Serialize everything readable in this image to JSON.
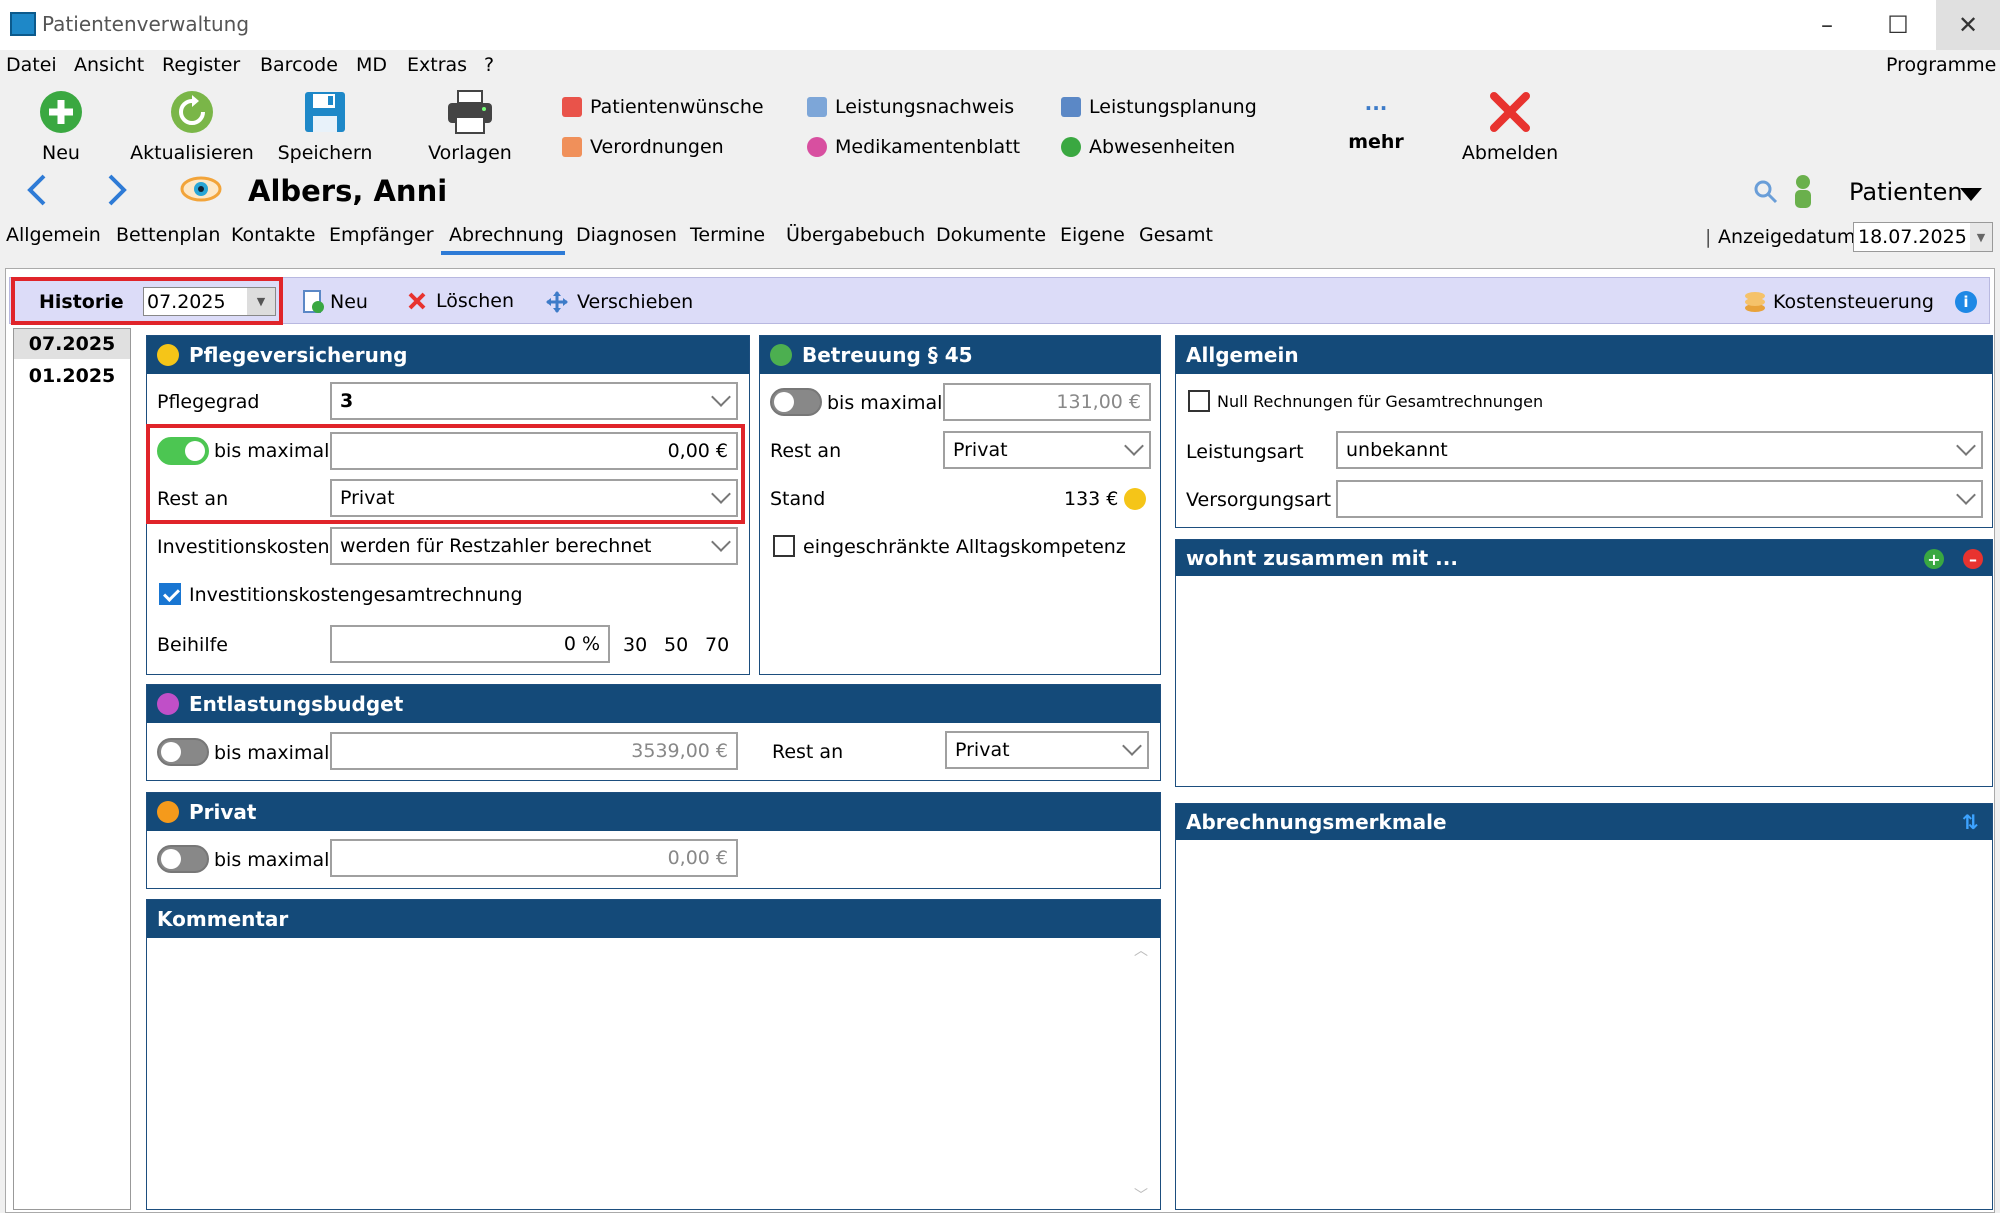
{
  "window": {
    "title": "Patientenverwaltung"
  },
  "menu": [
    "Datei",
    "Ansicht",
    "Register",
    "Barcode",
    "MD",
    "Extras",
    "?"
  ],
  "programs_label": "Programme",
  "toolbar": {
    "new": "Neu",
    "refresh": "Aktualisieren",
    "save": "Speichern",
    "templates": "Vorlagen",
    "patient_wishes": "Patientenwünsche",
    "prescriptions": "Verordnungen",
    "service_record": "Leistungsnachweis",
    "medication_sheet": "Medikamentenblatt",
    "service_planning": "Leistungsplanung",
    "absences": "Abwesenheiten",
    "more_dots": "···",
    "more": "mehr",
    "logout": "Abmelden"
  },
  "patient": {
    "name": "Albers, Anni",
    "selector": "Patienten"
  },
  "tabs": [
    "Allgemein",
    "Bettenplan",
    "Kontakte",
    "Empfänger",
    "Abrechnung",
    "Diagnosen",
    "Termine",
    "Übergabebuch",
    "Dokumente",
    "Eigene",
    "Gesamt"
  ],
  "active_tab": "Abrechnung",
  "display_date": {
    "label": "Anzeigedatum",
    "value": "18.07.2025"
  },
  "history": {
    "label": "Historie",
    "selected": "07.2025",
    "new": "Neu",
    "delete": "Löschen",
    "move": "Verschieben",
    "cost_control": "Kostensteuerung",
    "entries": [
      "07.2025",
      "01.2025"
    ]
  },
  "pflege": {
    "title": "Pflegeversicherung",
    "grade_label": "Pflegegrad",
    "grade_value": "3",
    "max_label": "bis maximal",
    "max_value": "0,00 €",
    "max_enabled": true,
    "rest_label": "Rest an",
    "rest_value": "Privat",
    "invest_label": "Investitionskosten",
    "invest_value": "werden für Restzahler berechnet",
    "invest_total_label": "Investitionskostengesamtrechnung",
    "invest_total_checked": true,
    "aid_label": "Beihilfe",
    "aid_value": "0 %",
    "aid_presets": [
      "30",
      "50",
      "70"
    ]
  },
  "betreuung": {
    "title": "Betreuung § 45",
    "max_label": "bis maximal",
    "max_value": "131,00 €",
    "max_enabled": false,
    "rest_label": "Rest an",
    "rest_value": "Privat",
    "stand_label": "Stand",
    "stand_value": "133 €",
    "limited_label": "eingeschränkte Alltagskompetenz",
    "limited_checked": false
  },
  "entlastung": {
    "title": "Entlastungsbudget",
    "max_label": "bis maximal",
    "max_value": "3539,00 €",
    "max_enabled": false,
    "rest_label": "Rest an",
    "rest_value": "Privat"
  },
  "privat": {
    "title": "Privat",
    "max_label": "bis maximal",
    "max_value": "0,00 €",
    "max_enabled": false
  },
  "comment": {
    "title": "Kommentar"
  },
  "general": {
    "title": "Allgemein",
    "null_invoices_label": "Null Rechnungen für Gesamtrechnungen",
    "null_invoices_checked": false,
    "service_type_label": "Leistungsart",
    "service_type_value": "unbekannt",
    "care_type_label": "Versorgungsart",
    "care_type_value": ""
  },
  "lives_with": {
    "title": "wohnt zusammen mit ..."
  },
  "billing_features": {
    "title": "Abrechnungsmerkmale"
  },
  "colors": {
    "panel_header": "#144a79",
    "highlight": "#e0242a",
    "toggle_on": "#4cc652",
    "pflege_dot": "#f5c518",
    "betreuung_dot": "#4caf50",
    "entlastung_dot": "#c04fc8",
    "privat_dot": "#f59a1b"
  }
}
